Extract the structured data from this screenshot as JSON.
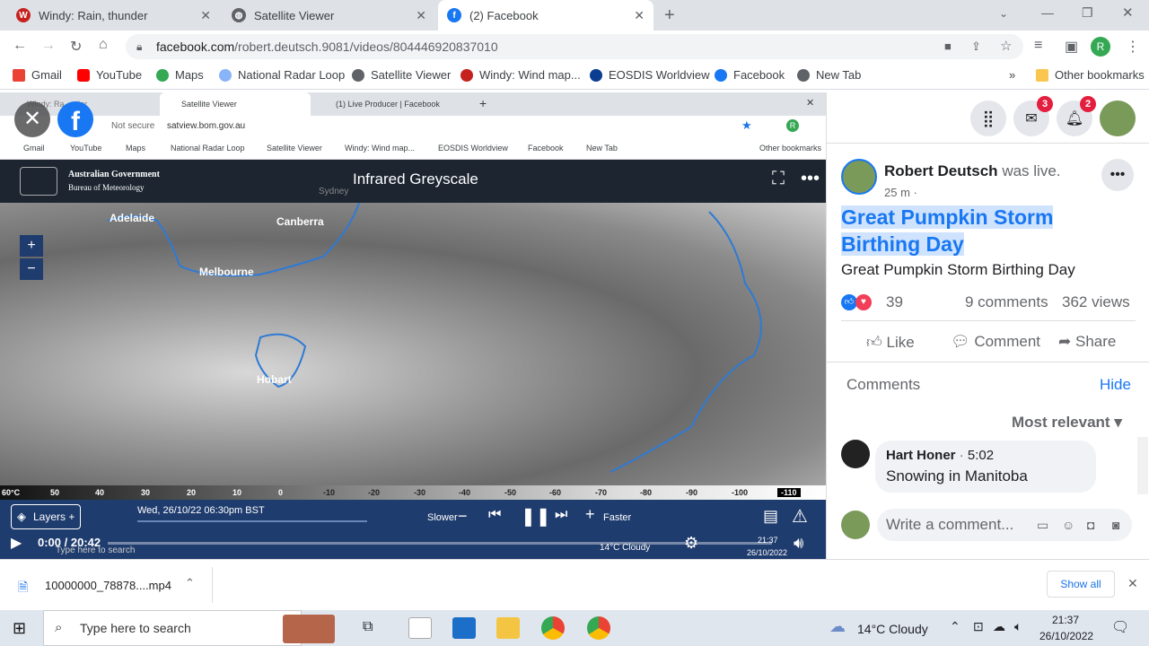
{
  "tabs": [
    {
      "title": "Windy: Rain, thunder",
      "color": "#c5221f"
    },
    {
      "title": "Satellite Viewer",
      "color": "#5f6368"
    },
    {
      "title": "(2) Facebook",
      "color": "#1877f2"
    }
  ],
  "new_tab_label": "+",
  "address": {
    "domain": "facebook.com",
    "path": "/robert.deutsch.9081/videos/804446920837010"
  },
  "profile_initial": "R",
  "bookmarks": [
    "Gmail",
    "YouTube",
    "Maps",
    "National Radar Loop",
    "Satellite Viewer",
    "Windy: Wind map...",
    "EOSDIS Worldview",
    "Facebook",
    "New Tab"
  ],
  "other_bookmarks": "Other bookmarks",
  "overflow": "»",
  "video": {
    "inner_tabs": [
      "Windy: Ra...nder",
      "Satellite Viewer",
      "(1) Live Producer | Facebook"
    ],
    "inner_not_secure": "Not secure",
    "inner_url": "satview.bom.gov.au",
    "inner_bookmarks": [
      "Gmail",
      "YouTube",
      "Maps",
      "National Radar Loop",
      "Satellite Viewer",
      "Windy: Wind map...",
      "EOSDIS Worldview",
      "Facebook",
      "New Tab"
    ],
    "inner_other": "Other bookmarks",
    "gov_line1": "Australian Government",
    "gov_line2": "Bureau of Meteorology",
    "sat_title": "Infrared Greyscale",
    "sydney": "Sydney",
    "cities": [
      "Adelaide",
      "Canberra",
      "Melbourne",
      "Hobart"
    ],
    "zoom_in": "+",
    "zoom_out": "−",
    "scale_labels": [
      "60°C",
      "50",
      "40",
      "30",
      "20",
      "10",
      "0",
      "-10",
      "-20",
      "-30",
      "-40",
      "-50",
      "-60",
      "-70",
      "-80",
      "-90",
      "-100",
      "-110"
    ],
    "layers_label": "Layers +",
    "datetime": "Wed, 26/10/22 06:30pm BST",
    "slower": "Slower",
    "faster": "Faster",
    "time": "0:00 / 20:42",
    "inner_search": "Type here to search",
    "inner_weather": "14°C Cloudy",
    "inner_clock": "21:37",
    "inner_date": "26/10/2022"
  },
  "fb": {
    "messenger_badge": "3",
    "notif_badge": "2",
    "author": "Robert Deutsch",
    "was_live": "was live.",
    "time_ago": "25 m ·",
    "title": "Great Pumpkin Storm Birthing Day",
    "description": "Great Pumpkin Storm Birthing Day",
    "reactions": "39",
    "comments_count": "9 comments",
    "views": "362 views",
    "like": "Like",
    "comment": "Comment",
    "share": "Share",
    "comments_label": "Comments",
    "hide": "Hide",
    "most_relevant": "Most relevant",
    "commenter": "Hart Honer",
    "comment_time": "5:02",
    "comment_text": "Snowing in Manitoba",
    "write_placeholder": "Write a comment..."
  },
  "download": {
    "file": "10000000_78878....mp4",
    "show_all": "Show all"
  },
  "taskbar": {
    "search": "Type here to search",
    "weather": "14°C  Cloudy",
    "clock": "21:37",
    "date": "26/10/2022"
  },
  "colors": {
    "fb_blue": "#1877f2",
    "chrome_tabstrip": "#dee1e6",
    "bom_bar": "#1f3c6e",
    "highlight": "#cfe3ff"
  }
}
